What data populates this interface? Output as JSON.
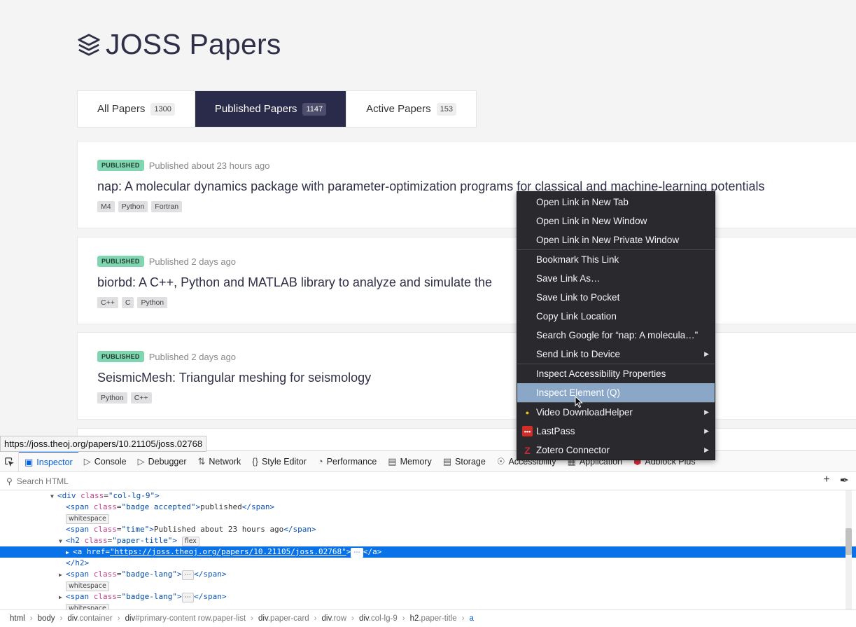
{
  "page": {
    "title": "JOSS Papers",
    "icon": "layers-icon",
    "tabs": [
      {
        "label": "All Papers",
        "count": "1300"
      },
      {
        "label": "Published Papers",
        "count": "1147"
      },
      {
        "label": "Active Papers",
        "count": "153"
      }
    ],
    "papers": [
      {
        "badge": "PUBLISHED",
        "time": "Published about 23 hours ago",
        "title": "nap: A molecular dynamics package with parameter-optimization programs for classical and machine-learning potentials",
        "langs": [
          "M4",
          "Python",
          "Fortran"
        ]
      },
      {
        "badge": "PUBLISHED",
        "time": "Published 2 days ago",
        "title": "biorbd: A C++, Python and MATLAB library to analyze and simulate the",
        "langs": [
          "C++",
          "C",
          "Python"
        ]
      },
      {
        "badge": "PUBLISHED",
        "time": "Published 2 days ago",
        "title": "SeismicMesh: Triangular meshing for seismology",
        "langs": [
          "Python",
          "C++"
        ]
      }
    ]
  },
  "status_url": "https://joss.theoj.org/papers/10.21105/joss.02768",
  "context_menu": {
    "items": [
      "Open Link in New Tab",
      "Open Link in New Window",
      "Open Link in New Private Window",
      "Bookmark This Link",
      "Save Link As…",
      "Save Link to Pocket",
      "Copy Link Location",
      "Search Google for “nap: A molecula…”",
      "Send Link to Device",
      "Inspect Accessibility Properties",
      "Inspect Element (Q)",
      "Video DownloadHelper",
      "LastPass",
      "Zotero Connector"
    ]
  },
  "devtools": {
    "tabs": [
      "Inspector",
      "Console",
      "Debugger",
      "Network",
      "Style Editor",
      "Performance",
      "Memory",
      "Storage",
      "Accessibility",
      "Application",
      "Adblock Plus"
    ],
    "search_placeholder": "Search HTML",
    "tree": {
      "div_class": "col-lg-9",
      "span1_class": "badge accepted",
      "span1_text": "published",
      "whitespace": "whitespace",
      "span2_class": "time",
      "span2_text": "Published about 23 hours ago",
      "h2_class": "paper-title",
      "flex": "flex",
      "href": "https://joss.theoj.org/papers/10.21105/joss.02768",
      "badge_lang": "badge-lang"
    },
    "breadcrumbs": [
      {
        "tag": "html",
        "cls": ""
      },
      {
        "tag": "body",
        "cls": ""
      },
      {
        "tag": "div",
        "cls": ".container"
      },
      {
        "tag": "div",
        "cls": "#primary-content row.paper-list"
      },
      {
        "tag": "div",
        "cls": ".paper-card"
      },
      {
        "tag": "div",
        "cls": ".row"
      },
      {
        "tag": "div",
        "cls": ".col-lg-9"
      },
      {
        "tag": "h2",
        "cls": ".paper-title"
      },
      {
        "tag": "a",
        "cls": ""
      }
    ]
  }
}
